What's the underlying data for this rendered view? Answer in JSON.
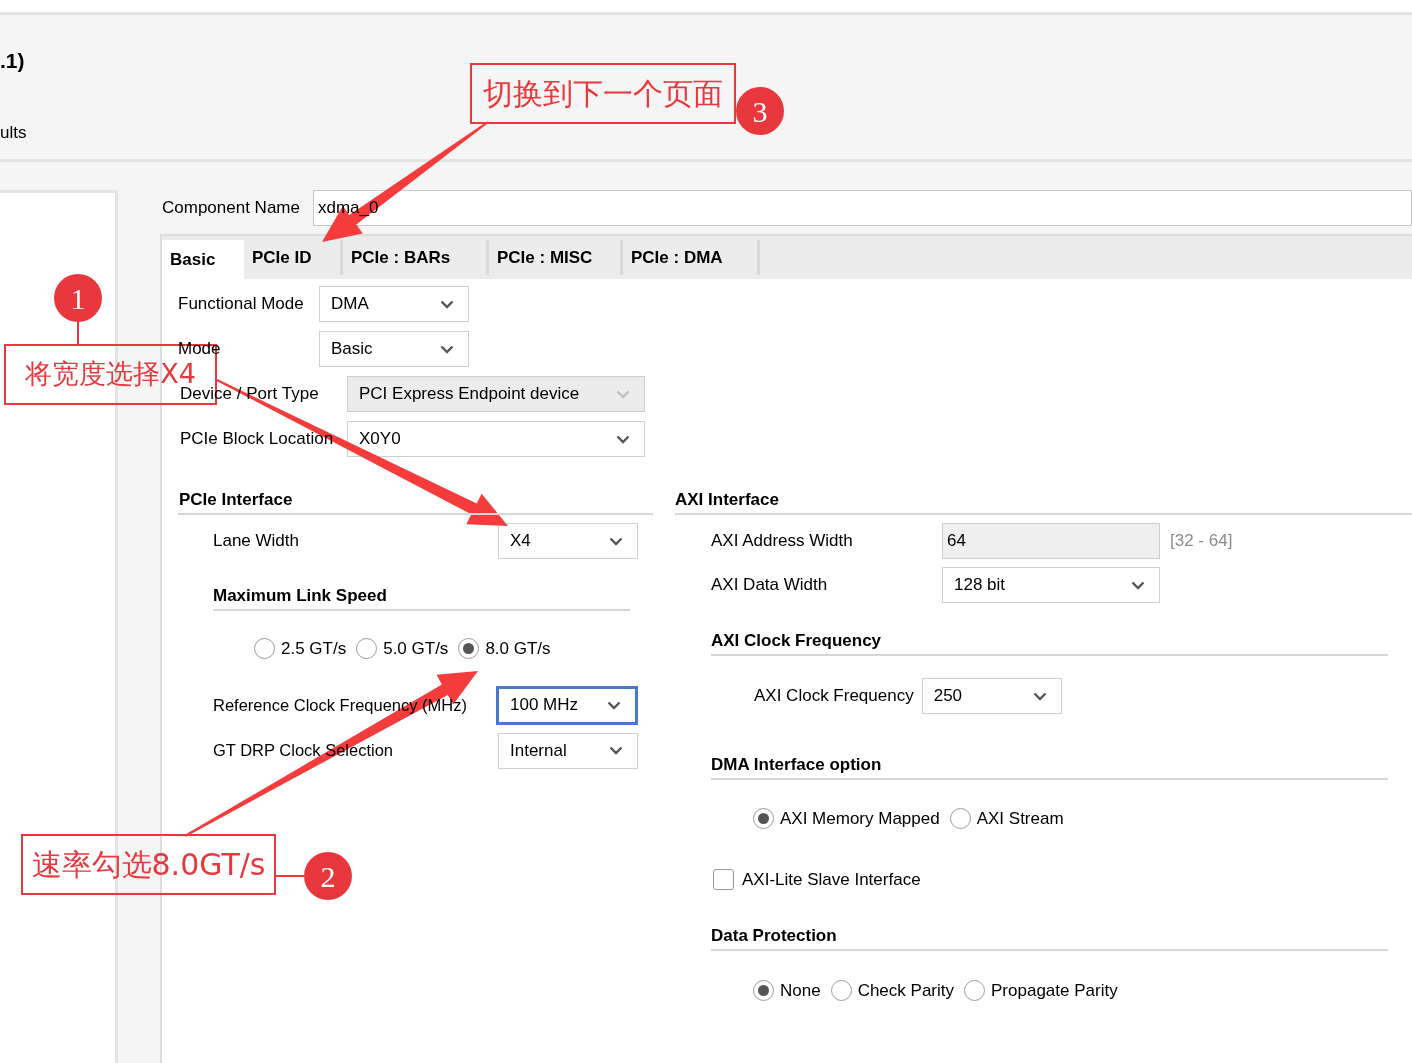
{
  "header": {
    "title_fragment": ".1)",
    "subtitle_fragment": "ults"
  },
  "component_name": {
    "label": "Component Name",
    "value": "xdma_0"
  },
  "tabs": [
    {
      "label": "Basic",
      "selected": true
    },
    {
      "label": "PCIe ID",
      "selected": false
    },
    {
      "label": "PCIe : BARs",
      "selected": false
    },
    {
      "label": "PCIe : MISC",
      "selected": false
    },
    {
      "label": "PCIe : DMA",
      "selected": false
    }
  ],
  "basic_fields": [
    {
      "label": "Functional Mode",
      "value": "DMA",
      "disabled": false
    },
    {
      "label": "Mode",
      "value": "Basic",
      "disabled": false
    },
    {
      "label": "Device / Port Type",
      "value": "PCI Express Endpoint device",
      "disabled": true
    },
    {
      "label": "PCIe Block Location",
      "value": "X0Y0",
      "disabled": false
    }
  ],
  "pcie_interface": {
    "title": "PCIe Interface",
    "lane_width": {
      "label": "Lane Width",
      "value": "X4"
    },
    "link_speed": {
      "title": "Maximum Link Speed",
      "options": [
        {
          "label": "2.5 GT/s",
          "selected": false
        },
        {
          "label": "5.0 GT/s",
          "selected": false
        },
        {
          "label": "8.0 GT/s",
          "selected": true
        }
      ]
    },
    "fields": [
      {
        "label": "Reference Clock Frequency (MHz)",
        "value": "100 MHz",
        "focused": true
      },
      {
        "label": "GT DRP Clock Selection",
        "value": "Internal",
        "focused": false
      }
    ]
  },
  "axi_interface": {
    "title": "AXI Interface",
    "address_width": {
      "label": "AXI Address Width",
      "value": "64",
      "range": "[32 - 64]"
    },
    "data_width": {
      "label": "AXI Data Width",
      "value": "128 bit"
    }
  },
  "axi_clock": {
    "title": "AXI Clock Frequency",
    "label": "AXI Clock Frequency",
    "value": "250"
  },
  "dma_interface": {
    "title": "DMA Interface option",
    "options": [
      {
        "label": "AXI Memory Mapped",
        "selected": true
      },
      {
        "label": "AXI Stream",
        "selected": false
      }
    ]
  },
  "axi_lite": {
    "label": "AXI-Lite Slave Interface",
    "checked": false
  },
  "data_protection": {
    "title": "Data Protection",
    "options": [
      {
        "label": "None",
        "selected": true
      },
      {
        "label": "Check Parity",
        "selected": false
      },
      {
        "label": "Propagate Parity",
        "selected": false
      }
    ]
  },
  "annotations": [
    {
      "number": "1",
      "text": "将宽度选择X4"
    },
    {
      "number": "2",
      "text": "速率勾选8.0GT/s"
    },
    {
      "number": "3",
      "text": "切换到下一个页面"
    }
  ]
}
